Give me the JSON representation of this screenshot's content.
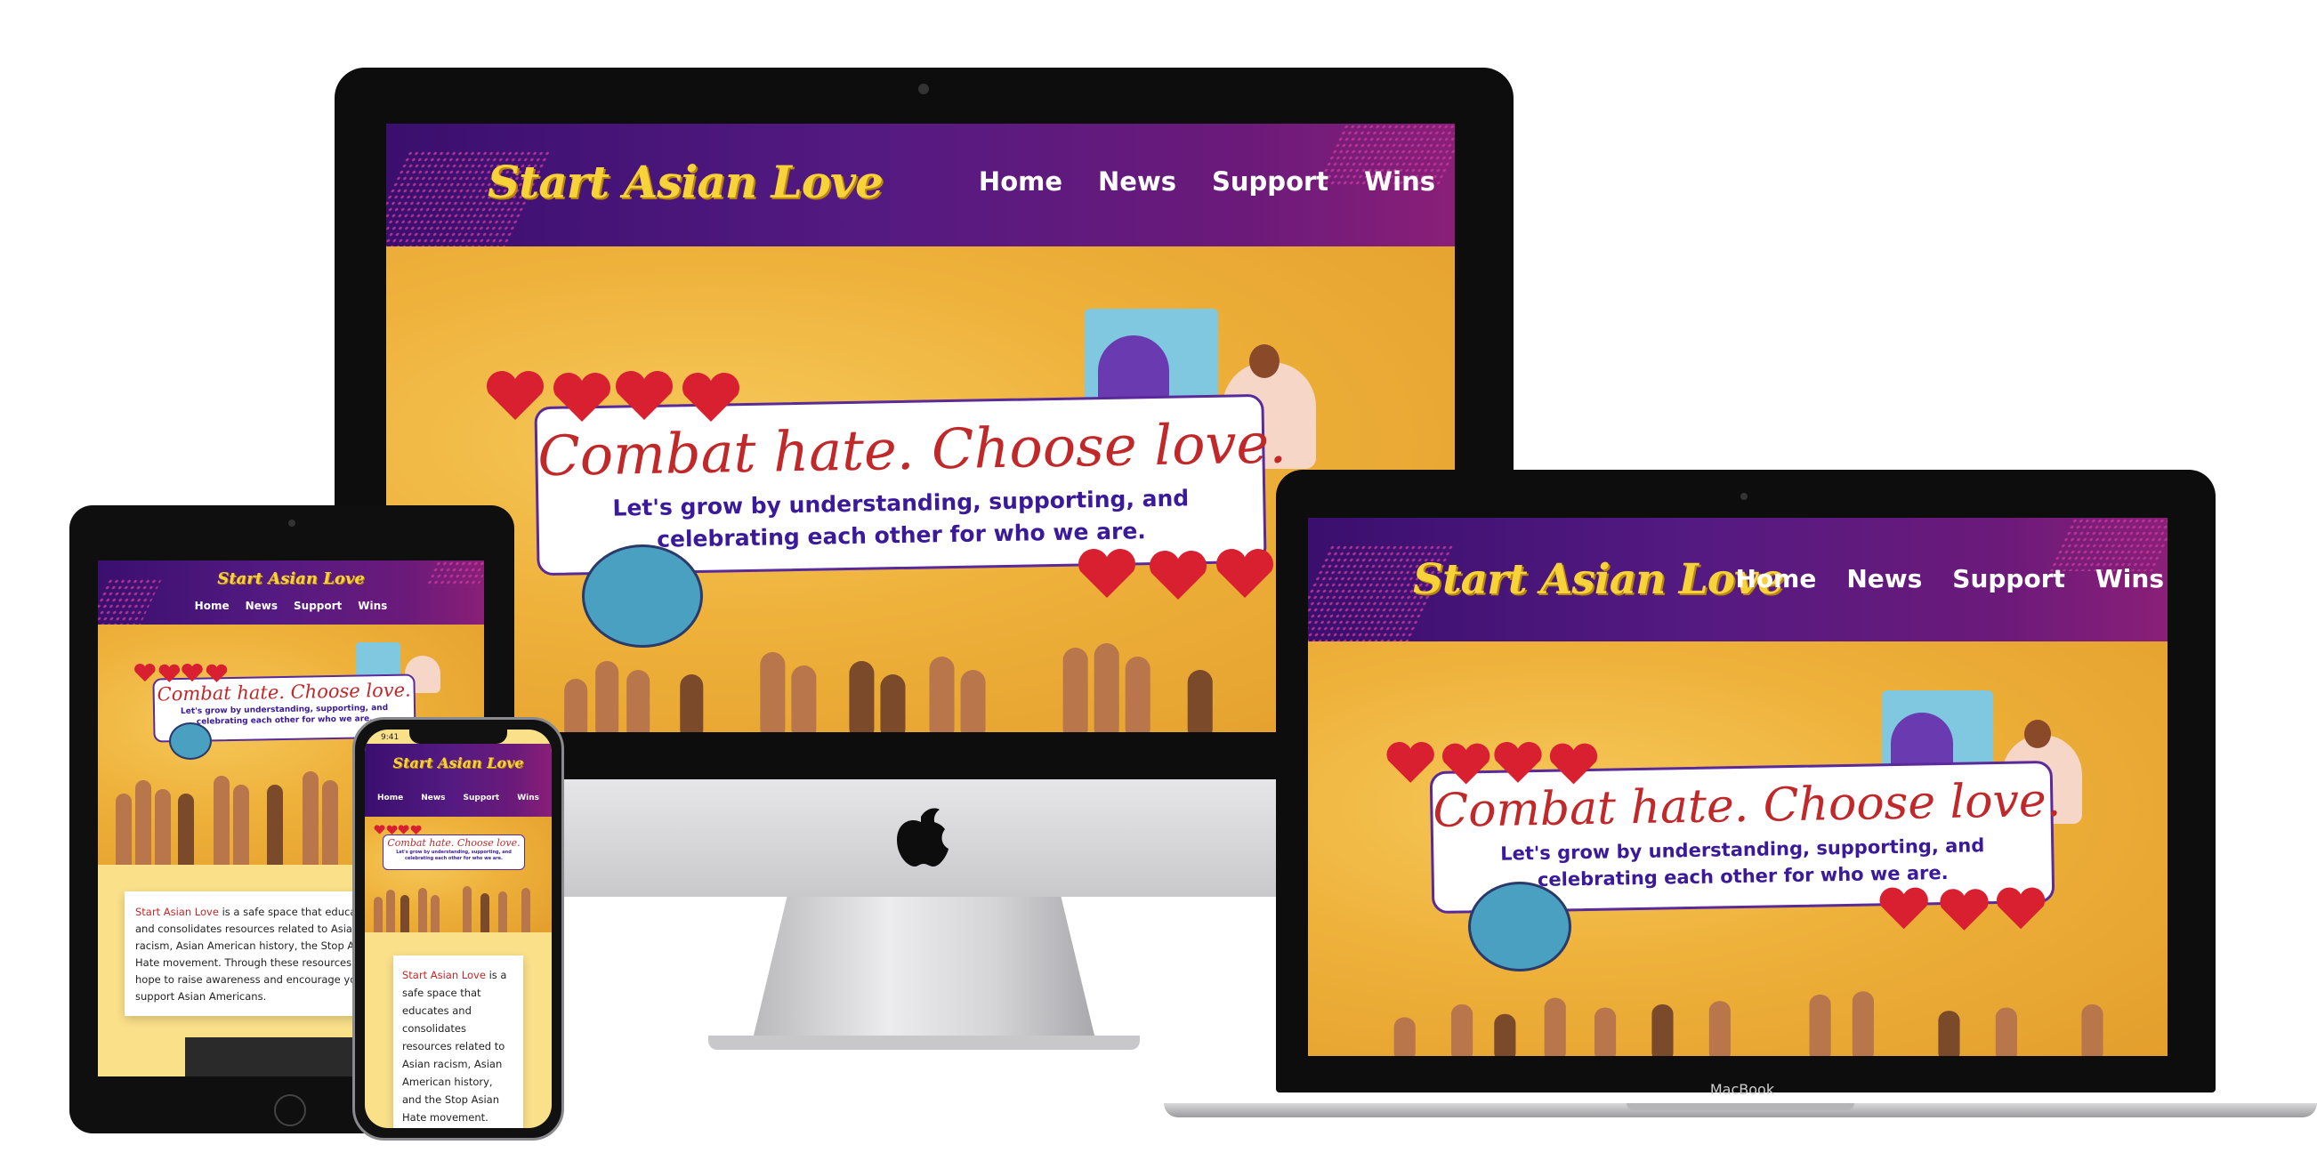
{
  "site": {
    "logo": "Start Asian Love",
    "nav": [
      "Home",
      "News",
      "Support",
      "Wins"
    ],
    "headline": "Combat hate. Choose love.",
    "subline": "Let's grow by understanding, supporting, and celebrating each other for who we are.",
    "about_highlight": "Start Asian Love",
    "about_tablet": " is a safe space that educates and consolidates resources related to Asian racism, Asian American history, the Stop Asian Hate movement. Through these resources we hope to raise awareness and encourage you to support Asian Americans.",
    "about_phone": " is a safe space that educates and consolidates resources related to Asian racism, Asian American history, and the Stop Asian Hate movement. Through these resources we hope to raise awareness"
  },
  "phone": {
    "status_time": "9:41"
  },
  "laptop": {
    "brand": "MacBook"
  },
  "colors": {
    "header": "#541a82",
    "logo": "#f8d23a",
    "hero": "#f0b43a",
    "accent": "#c0282a",
    "subtext": "#3a1a9a"
  }
}
